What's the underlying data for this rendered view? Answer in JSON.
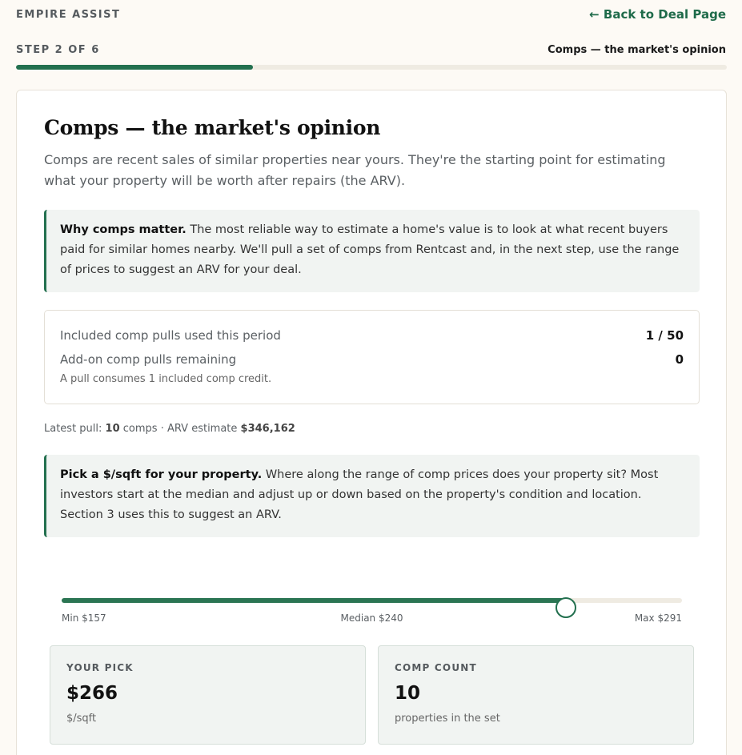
{
  "header": {
    "brand": "EMPIRE ASSIST",
    "back_link": "← Back to Deal Page"
  },
  "progress": {
    "step_label": "STEP 2 OF 6",
    "step_title": "Comps — the market's opinion",
    "current_step": 2,
    "total_steps": 6,
    "fraction": 0.333
  },
  "main": {
    "title": "Comps — the market's opinion",
    "intro": "Comps are recent sales of similar properties near yours. They're the starting point for estimating what your property will be worth after repairs (the ARV).",
    "callout_1": {
      "bold": "Why comps matter.",
      "text": " The most reliable way to estimate a home's value is to look at what recent buyers paid for similar homes nearby. We'll pull a set of comps from Rentcast and, in the next step, use the range of prices to suggest an ARV for your deal."
    },
    "credits": {
      "included_label": "Included comp pulls used this period",
      "included_value": "1 / 50",
      "addon_label": "Add-on comp pulls remaining",
      "addon_value": "0",
      "note": "A pull consumes 1 included comp credit."
    },
    "latest": {
      "prefix": "Latest pull: ",
      "count": "10",
      "mid": " comps · ARV estimate ",
      "arv": "$346,162"
    },
    "callout_2": {
      "bold": "Pick a $/sqft for your property.",
      "text": " Where along the range of comp prices does your property sit? Most investors start at the median and adjust up or down based on the property's condition and location. Section 3 uses this to suggest an ARV."
    },
    "slider": {
      "min": 157,
      "max": 291,
      "value": 266,
      "min_label": "Min $157",
      "median_label": "Median $240",
      "max_label": "Max $291"
    },
    "pick": {
      "label": "YOUR PICK",
      "value": "$266",
      "unit": "$/sqft"
    },
    "comp_count": {
      "label": "COMP COUNT",
      "value": "10",
      "unit": "properties in the set"
    }
  },
  "colors": {
    "accent": "#23704f",
    "background": "#fdfaf5",
    "callout_bg": "#f1f4f2"
  }
}
